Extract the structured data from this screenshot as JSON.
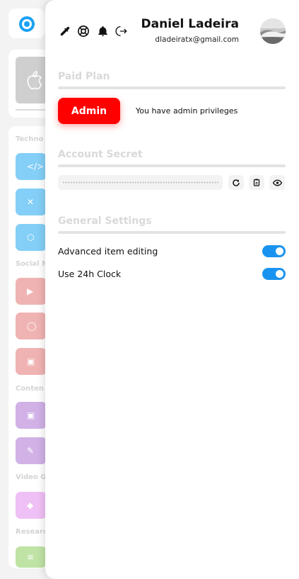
{
  "background": {
    "sections": [
      "Techno",
      "Social M",
      "Conten",
      "Video G",
      "Researc"
    ],
    "tile_icons": [
      "code-icon",
      "tools-icon",
      "cube-icon",
      "youtube-icon",
      "chat-icon",
      "media-icon",
      "media-icon",
      "pencil-icon",
      "gamepad-icon",
      "list-icon"
    ]
  },
  "topbar": {
    "icons": [
      "eyedropper-icon",
      "lifebuoy-icon",
      "bell-icon",
      "logout-icon"
    ],
    "user_name": "Daniel Ladeira",
    "user_email": "dladeiratx@gmail.com"
  },
  "paid_plan": {
    "title": "Paid Plan",
    "badge_label": "Admin",
    "note": "You have admin privileges"
  },
  "account_secret": {
    "title": "Account Secret",
    "masked_value": "••••••••••••••••••••••••••••••••••••••••••••••••••••••••••••••••••••",
    "actions": [
      "refresh-icon",
      "clipboard-icon",
      "eye-icon"
    ]
  },
  "general_settings": {
    "title": "General Settings",
    "items": [
      {
        "label": "Advanced item editing",
        "enabled": true
      },
      {
        "label": "Use 24h Clock",
        "enabled": true
      }
    ]
  },
  "colors": {
    "accent": "#1a93f0",
    "admin": "#ff0000"
  }
}
